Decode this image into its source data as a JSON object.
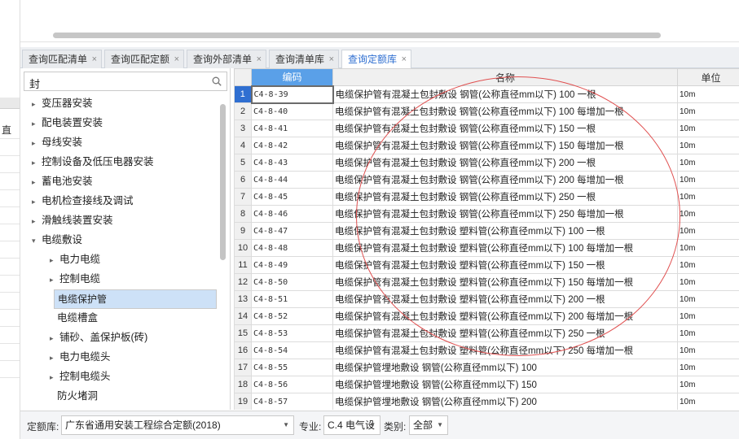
{
  "tabs": [
    {
      "label": "查询匹配清单",
      "close": "×"
    },
    {
      "label": "查询匹配定额",
      "close": "×"
    },
    {
      "label": "查询外部清单",
      "close": "×"
    },
    {
      "label": "查询清单库",
      "close": "×"
    },
    {
      "label": "查询定额库",
      "close": "×"
    }
  ],
  "search": {
    "value": "封",
    "icon": "search-icon"
  },
  "left_strip": {
    "header_char": "直"
  },
  "tree": [
    {
      "label": "变压器安装",
      "expand": "▸"
    },
    {
      "label": "配电装置安装",
      "expand": "▸"
    },
    {
      "label": "母线安装",
      "expand": "▸"
    },
    {
      "label": "控制设备及低压电器安装",
      "expand": "▸"
    },
    {
      "label": "蓄电池安装",
      "expand": "▸"
    },
    {
      "label": "电机检查接线及调试",
      "expand": "▸"
    },
    {
      "label": "滑触线装置安装",
      "expand": "▸"
    },
    {
      "label": "电缆敷设",
      "expand": "▾"
    },
    {
      "label": "电力电缆",
      "expand": "▸"
    },
    {
      "label": "控制电缆",
      "expand": "▸"
    },
    {
      "label": "电缆保护管",
      "expand": ""
    },
    {
      "label": "电缆槽盒",
      "expand": ""
    },
    {
      "label": "铺砂、盖保护板(砖)",
      "expand": "▸"
    },
    {
      "label": "电力电缆头",
      "expand": "▸"
    },
    {
      "label": "控制电缆头",
      "expand": "▸"
    },
    {
      "label": "防火堵洞",
      "expand": ""
    }
  ],
  "grid": {
    "headers": {
      "code": "编码",
      "name": "名称",
      "unit": "单位"
    },
    "rows": [
      {
        "num": "1",
        "code": "C4-8-39",
        "name": "电缆保护管有混凝土包封敷设 钢管(公称直径mm以下) 100 一根",
        "unit": "10m"
      },
      {
        "num": "2",
        "code": "C4-8-40",
        "name": "电缆保护管有混凝土包封敷设 钢管(公称直径mm以下) 100 每增加一根",
        "unit": "10m"
      },
      {
        "num": "3",
        "code": "C4-8-41",
        "name": "电缆保护管有混凝土包封敷设 钢管(公称直径mm以下) 150 一根",
        "unit": "10m"
      },
      {
        "num": "4",
        "code": "C4-8-42",
        "name": "电缆保护管有混凝土包封敷设 钢管(公称直径mm以下) 150 每增加一根",
        "unit": "10m"
      },
      {
        "num": "5",
        "code": "C4-8-43",
        "name": "电缆保护管有混凝土包封敷设 钢管(公称直径mm以下) 200 一根",
        "unit": "10m"
      },
      {
        "num": "6",
        "code": "C4-8-44",
        "name": "电缆保护管有混凝土包封敷设 钢管(公称直径mm以下) 200 每增加一根",
        "unit": "10m"
      },
      {
        "num": "7",
        "code": "C4-8-45",
        "name": "电缆保护管有混凝土包封敷设 钢管(公称直径mm以下) 250 一根",
        "unit": "10m"
      },
      {
        "num": "8",
        "code": "C4-8-46",
        "name": "电缆保护管有混凝土包封敷设 钢管(公称直径mm以下) 250 每增加一根",
        "unit": "10m"
      },
      {
        "num": "9",
        "code": "C4-8-47",
        "name": "电缆保护管有混凝土包封敷设 塑料管(公称直径mm以下) 100 一根",
        "unit": "10m"
      },
      {
        "num": "10",
        "code": "C4-8-48",
        "name": "电缆保护管有混凝土包封敷设 塑料管(公称直径mm以下) 100 每增加一根",
        "unit": "10m"
      },
      {
        "num": "11",
        "code": "C4-8-49",
        "name": "电缆保护管有混凝土包封敷设 塑料管(公称直径mm以下) 150 一根",
        "unit": "10m"
      },
      {
        "num": "12",
        "code": "C4-8-50",
        "name": "电缆保护管有混凝土包封敷设 塑料管(公称直径mm以下) 150 每增加一根",
        "unit": "10m"
      },
      {
        "num": "13",
        "code": "C4-8-51",
        "name": "电缆保护管有混凝土包封敷设 塑料管(公称直径mm以下) 200 一根",
        "unit": "10m"
      },
      {
        "num": "14",
        "code": "C4-8-52",
        "name": "电缆保护管有混凝土包封敷设 塑料管(公称直径mm以下) 200 每增加一根",
        "unit": "10m"
      },
      {
        "num": "15",
        "code": "C4-8-53",
        "name": "电缆保护管有混凝土包封敷设 塑料管(公称直径mm以下) 250 一根",
        "unit": "10m"
      },
      {
        "num": "16",
        "code": "C4-8-54",
        "name": "电缆保护管有混凝土包封敷设 塑料管(公称直径mm以下) 250 每增加一根",
        "unit": "10m"
      },
      {
        "num": "17",
        "code": "C4-8-55",
        "name": "电缆保护管埋地敷设 钢管(公称直径mm以下) 100",
        "unit": "10m"
      },
      {
        "num": "18",
        "code": "C4-8-56",
        "name": "电缆保护管埋地敷设 钢管(公称直径mm以下) 150",
        "unit": "10m"
      },
      {
        "num": "19",
        "code": "C4-8-57",
        "name": "电缆保护管埋地敷设 钢管(公称直径mm以下) 200",
        "unit": "10m"
      }
    ]
  },
  "bottom": {
    "library_label": "定额库:",
    "library_value": "广东省通用安装工程综合定额(2018)",
    "specialty_label": "专业:",
    "specialty_value": "C.4 电气设",
    "category_label": "类别:",
    "category_value": "全部"
  },
  "colors": {
    "accent": "#2f6fd1",
    "header_highlight": "#5aa0e8",
    "selection": "#cde1f7",
    "annotation": "#e05050"
  }
}
